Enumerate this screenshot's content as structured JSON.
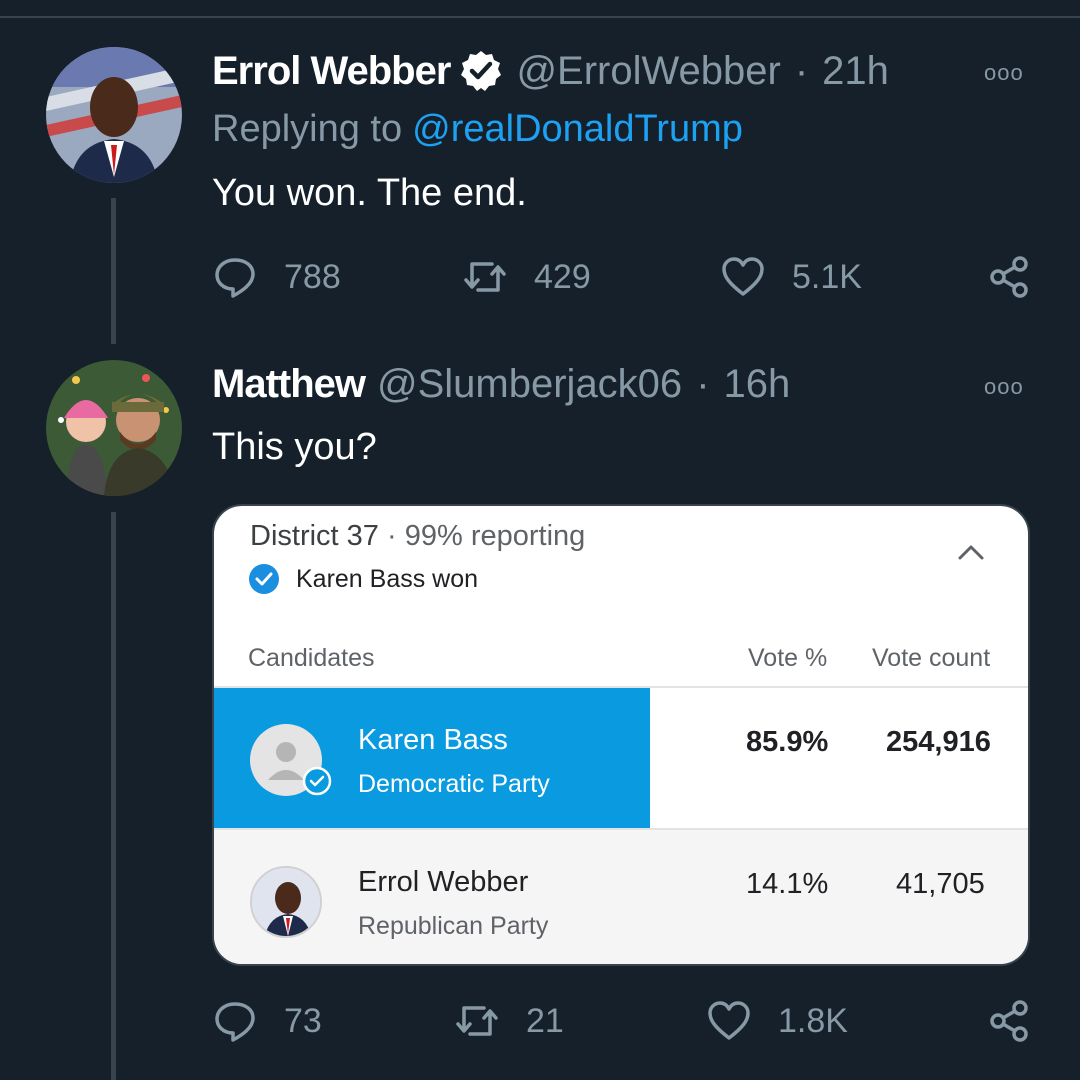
{
  "tweets": [
    {
      "display_name": "Errol Webber",
      "verified": true,
      "handle": "@ErrolWebber",
      "separator": "·",
      "time": "21h",
      "replying_prefix": "Replying to",
      "replying_to": "@realDonaldTrump",
      "text": "You won. The end.",
      "stats": {
        "replies": "788",
        "retweets": "429",
        "likes": "5.1K"
      }
    },
    {
      "display_name": "Matthew",
      "handle": "@Slumberjack06",
      "separator": "·",
      "time": "16h",
      "text": "This you?",
      "stats": {
        "replies": "73",
        "retweets": "21",
        "likes": "1.8K"
      }
    }
  ],
  "more_glyph": "ooo",
  "election_card": {
    "district": "District 37",
    "separator": "·",
    "reporting": "99% reporting",
    "winner_text": "Karen Bass won",
    "columns": {
      "candidates": "Candidates",
      "vote_pct": "Vote %",
      "vote_count": "Vote count"
    },
    "candidates": [
      {
        "name": "Karen Bass",
        "party": "Democratic Party",
        "vote_pct": "85.9%",
        "vote_count": "254,916",
        "winner": true
      },
      {
        "name": "Errol Webber",
        "party": "Republican Party",
        "vote_pct": "14.1%",
        "vote_count": "41,705",
        "winner": false
      }
    ]
  },
  "colors": {
    "background": "#15202b",
    "muted_text": "#8899a6",
    "link_blue": "#1da1f2",
    "winner_highlight": "#0a9ae0"
  },
  "icons": [
    "verified-badge-icon",
    "more-options-icon",
    "reply-icon",
    "retweet-icon",
    "like-icon",
    "share-icon",
    "check-circle-icon",
    "chevron-up-icon",
    "placeholder-person-icon"
  ]
}
